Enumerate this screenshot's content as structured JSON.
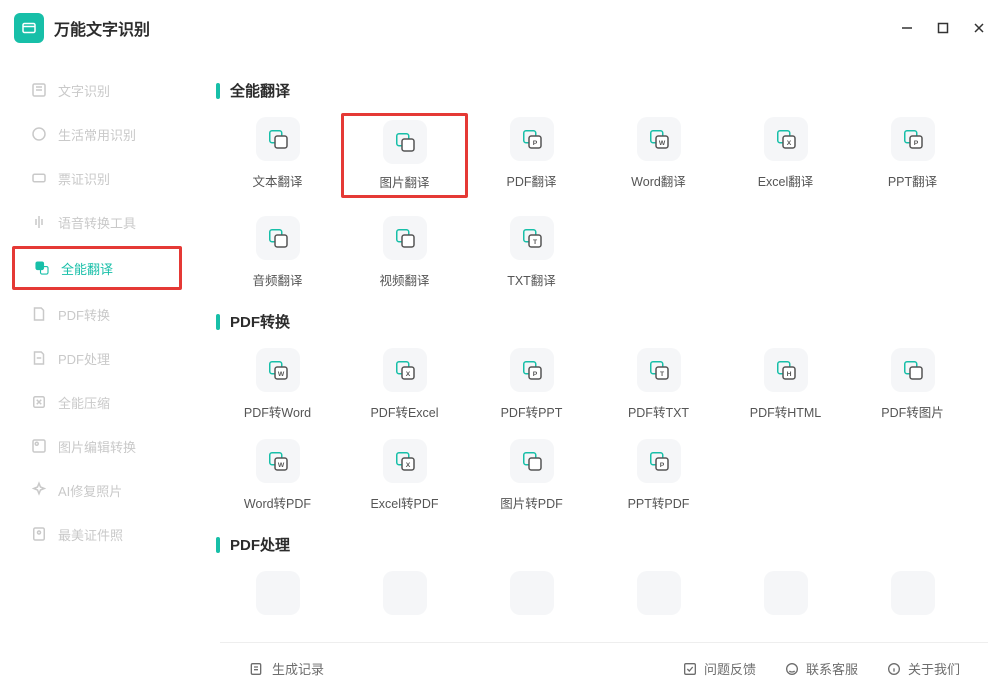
{
  "app": {
    "title": "万能文字识别"
  },
  "sidebar": {
    "items": [
      {
        "label": "文字识别",
        "active": false
      },
      {
        "label": "生活常用识别",
        "active": false
      },
      {
        "label": "票证识别",
        "active": false
      },
      {
        "label": "语音转换工具",
        "active": false
      },
      {
        "label": "全能翻译",
        "active": true,
        "highlighted": true
      },
      {
        "label": "PDF转换",
        "active": false
      },
      {
        "label": "PDF处理",
        "active": false
      },
      {
        "label": "全能压缩",
        "active": false
      },
      {
        "label": "图片编辑转换",
        "active": false
      },
      {
        "label": "AI修复照片",
        "active": false
      },
      {
        "label": "最美证件照",
        "active": false
      }
    ]
  },
  "sections": [
    {
      "title": "全能翻译",
      "tools": [
        {
          "label": "文本翻译",
          "icon": "text-translate-icon"
        },
        {
          "label": "图片翻译",
          "icon": "image-translate-icon",
          "highlighted": true
        },
        {
          "label": "PDF翻译",
          "icon": "pdf-translate-icon"
        },
        {
          "label": "Word翻译",
          "icon": "word-translate-icon"
        },
        {
          "label": "Excel翻译",
          "icon": "excel-translate-icon"
        },
        {
          "label": "PPT翻译",
          "icon": "ppt-translate-icon"
        },
        {
          "label": "音频翻译",
          "icon": "audio-translate-icon"
        },
        {
          "label": "视频翻译",
          "icon": "video-translate-icon"
        },
        {
          "label": "TXT翻译",
          "icon": "txt-translate-icon"
        }
      ]
    },
    {
      "title": "PDF转换",
      "tools": [
        {
          "label": "PDF转Word",
          "icon": "pdf-to-word-icon"
        },
        {
          "label": "PDF转Excel",
          "icon": "pdf-to-excel-icon"
        },
        {
          "label": "PDF转PPT",
          "icon": "pdf-to-ppt-icon"
        },
        {
          "label": "PDF转TXT",
          "icon": "pdf-to-txt-icon"
        },
        {
          "label": "PDF转HTML",
          "icon": "pdf-to-html-icon"
        },
        {
          "label": "PDF转图片",
          "icon": "pdf-to-image-icon"
        },
        {
          "label": "Word转PDF",
          "icon": "word-to-pdf-icon"
        },
        {
          "label": "Excel转PDF",
          "icon": "excel-to-pdf-icon"
        },
        {
          "label": "图片转PDF",
          "icon": "image-to-pdf-icon"
        },
        {
          "label": "PPT转PDF",
          "icon": "ppt-to-pdf-icon"
        }
      ]
    },
    {
      "title": "PDF处理",
      "tools": []
    }
  ],
  "bottombar": {
    "history": "生成记录",
    "feedback": "问题反馈",
    "support": "联系客服",
    "about": "关于我们"
  },
  "colors": {
    "accent": "#17bfa8",
    "highlight": "#e53935"
  }
}
